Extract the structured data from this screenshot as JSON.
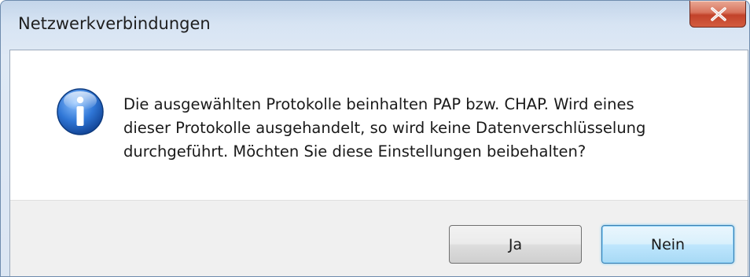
{
  "window": {
    "title": "Netzwerkverbindungen"
  },
  "dialog": {
    "icon": "info-icon",
    "message": "Die ausgewählten Protokolle beinhalten PAP bzw. CHAP. Wird eines\ndieser Protokolle ausgehandelt, so wird keine Datenverschlüsselung\ndurchgeführt. Möchten Sie diese Einstellungen beibehalten?"
  },
  "buttons": {
    "yes_label": "Ja",
    "no_label": "Nein"
  },
  "colors": {
    "close_button": "#c94a33",
    "info_icon": "#1f63c4",
    "default_button_border": "#3c7fb1"
  }
}
